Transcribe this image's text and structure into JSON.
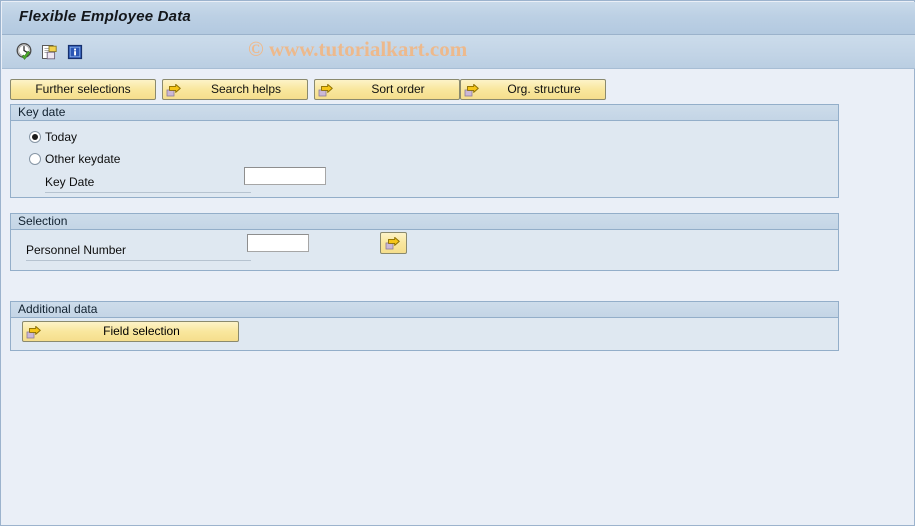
{
  "window": {
    "title": "Flexible Employee Data"
  },
  "watermark": {
    "text": "© www.tutorialkart.com",
    "color": "#edb98c"
  },
  "toolbar": {
    "icons": [
      {
        "name": "execute-icon",
        "label": "Execute"
      },
      {
        "name": "copy-icon",
        "label": "Copy"
      },
      {
        "name": "info-icon",
        "label": "Information"
      }
    ]
  },
  "button_row": {
    "buttons": [
      {
        "label": "Further selections",
        "icon": null
      },
      {
        "label": "Search helps",
        "icon": "arrow-right-icon"
      },
      {
        "label": "Sort order",
        "icon": "arrow-right-icon"
      },
      {
        "label": "Org. structure",
        "icon": "arrow-right-icon"
      }
    ]
  },
  "panels": {
    "key_date": {
      "title": "Key date",
      "radio_today": {
        "label": "Today",
        "selected": true
      },
      "radio_other": {
        "label": "Other keydate",
        "selected": false
      },
      "key_date_field": {
        "label": "Key Date",
        "value": "",
        "placeholder": ""
      }
    },
    "selection": {
      "title": "Selection",
      "personnel_number": {
        "label": "Personnel Number",
        "value": "",
        "placeholder": ""
      },
      "multi_select_button": {
        "name": "multiple-selection-button",
        "icon": "arrow-right-icon"
      }
    },
    "additional_data": {
      "title": "Additional data",
      "field_selection_button": {
        "label": "Field selection",
        "icon": "arrow-right-icon"
      }
    }
  },
  "colors": {
    "background": "#eaeff7",
    "panel_body": "#dfe8f1",
    "panel_header": "#c7d8e8",
    "panel_border": "#93aec9",
    "button_yellow": "#f9e79f",
    "button_border": "#8a8a6e",
    "title_bar": "#bcd0e4",
    "arrow_yellow": "#f5c518",
    "arrow_lilac": "#cbb8d6"
  }
}
